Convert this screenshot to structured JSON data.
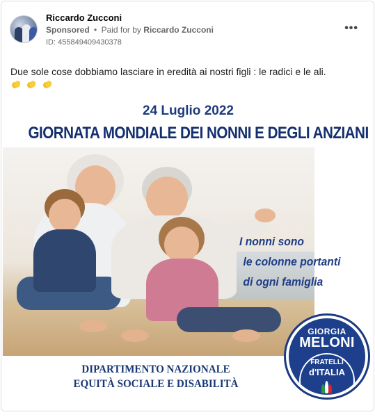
{
  "post": {
    "page_name": "Riccardo Zucconi",
    "sponsored_label": "Sponsored",
    "separator": "•",
    "paid_for_label": "Paid for by",
    "paid_for_name": "Riccardo Zucconi",
    "ad_id": "ID: 455849409430378",
    "more_icon": "more-options-icon",
    "text": "Due sole cose dobbiamo lasciare in eredità ai nostri figli : le radici e le ali.",
    "emojis": [
      "clapping-hands",
      "clapping-hands",
      "clapping-hands"
    ]
  },
  "ad_image": {
    "date": "24 Luglio 2022",
    "title": "GIORNATA MONDIALE DEI NONNI E DEGLI ANZIANI",
    "quote_lines": [
      "I nonni sono",
      "le colonne portanti",
      "di ogni famiglia"
    ],
    "department_lines": [
      "DIPARTIMENTO NAZIONALE",
      "EQUITÀ SOCIALE E DISABILITÀ"
    ],
    "logo": {
      "line1": "GIORGIA",
      "line2": "MELONI",
      "line3": "FRATELLI",
      "line4": "d'ITALIA"
    }
  },
  "colors": {
    "brand_blue": "#1d3f8c",
    "title_blue": "#142f6e",
    "meta_gray": "#65676b"
  }
}
